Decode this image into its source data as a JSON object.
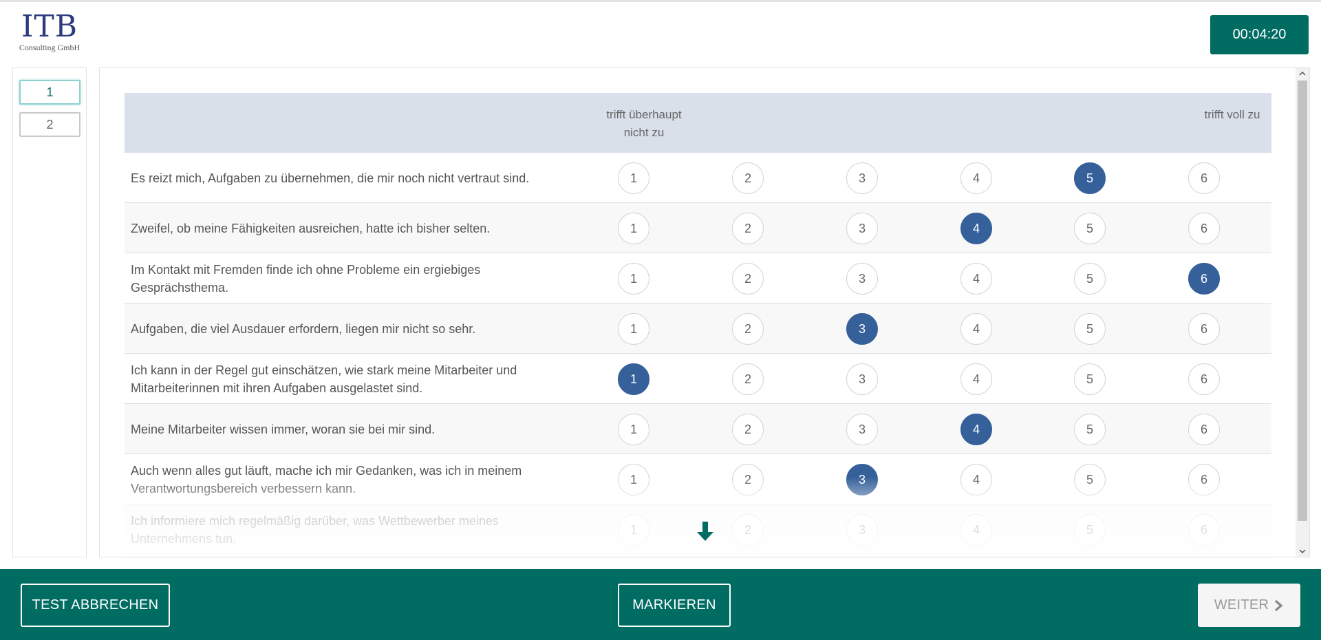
{
  "logo": {
    "brand": "ITB",
    "sub": "Consulting GmbH"
  },
  "timer": "00:04:20",
  "pages": [
    "1",
    "2"
  ],
  "active_page": 1,
  "scale": {
    "low_label_line1": "trifft überhaupt",
    "low_label_line2": "nicht zu",
    "high_label": "trifft voll zu",
    "options": [
      "1",
      "2",
      "3",
      "4",
      "5",
      "6"
    ]
  },
  "items": [
    {
      "text": "Es reizt mich, Aufgaben zu übernehmen, die mir noch nicht vertraut sind.",
      "selected": 5
    },
    {
      "text": "Zweifel, ob meine Fähigkeiten ausreichen, hatte ich bisher selten.",
      "selected": 4
    },
    {
      "text": "Im Kontakt mit Fremden finde ich ohne Probleme ein ergiebiges Gesprächsthema.",
      "selected": 6
    },
    {
      "text": "Aufgaben, die viel Ausdauer erfordern, liegen mir nicht so sehr.",
      "selected": 3
    },
    {
      "text": "Ich kann in der Regel gut einschätzen, wie stark meine Mitarbeiter und Mitarbeiterinnen mit ihren Aufgaben ausgelastet sind.",
      "selected": 1
    },
    {
      "text": "Meine Mitarbeiter wissen immer, woran sie bei mir sind.",
      "selected": 4
    },
    {
      "text": "Auch wenn alles gut läuft, mache ich mir Gedanken, was ich in meinem Verantwortungsbereich verbessern kann.",
      "selected": 3
    },
    {
      "text": "Ich informiere mich regelmäßig darüber, was Wettbewerber meines Unternehmens tun.",
      "selected": null
    }
  ],
  "footer": {
    "cancel_label": "TEST ABBRECHEN",
    "mark_label": "MARKIEREN",
    "next_label": "WEITER"
  },
  "colors": {
    "accent": "#016c62",
    "selected": "#35609a",
    "header_bg": "#d9e0ea",
    "logo": "#2d3a7c"
  },
  "icons": {
    "scroll_hint": "arrow-down-icon",
    "next": "chevron-right-icon"
  }
}
